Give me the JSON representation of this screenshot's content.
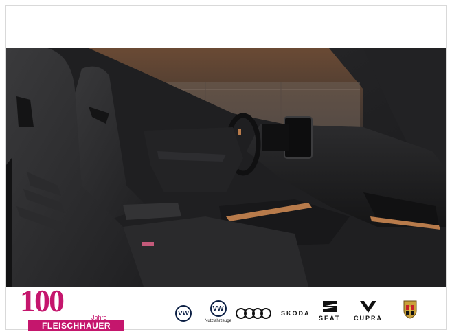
{
  "dealer": {
    "number": "100",
    "years_label": "Jahre",
    "name": "FLEISCHHAUER"
  },
  "brands": [
    {
      "name": "vw",
      "label": "VW"
    },
    {
      "name": "vw-commercial",
      "label": "VW",
      "caption": "Nutzfahrzeuge"
    },
    {
      "name": "audi",
      "label": ""
    },
    {
      "name": "skoda",
      "label": "SKODA"
    },
    {
      "name": "seat",
      "label": "SEAT"
    },
    {
      "name": "cupra",
      "label": "CUPRA"
    },
    {
      "name": "porsche",
      "label": ""
    }
  ],
  "colors": {
    "dealer_magenta": "#c5166d",
    "interior_dark": "#1d1d1f",
    "trim_copper": "#b87b4b",
    "vw_blue": "#0b1f44"
  },
  "icons": {
    "vw": "vw-logo-icon",
    "audi": "audi-rings-icon",
    "seat": "seat-logo-icon",
    "cupra": "cupra-logo-icon",
    "porsche": "porsche-crest-icon"
  }
}
